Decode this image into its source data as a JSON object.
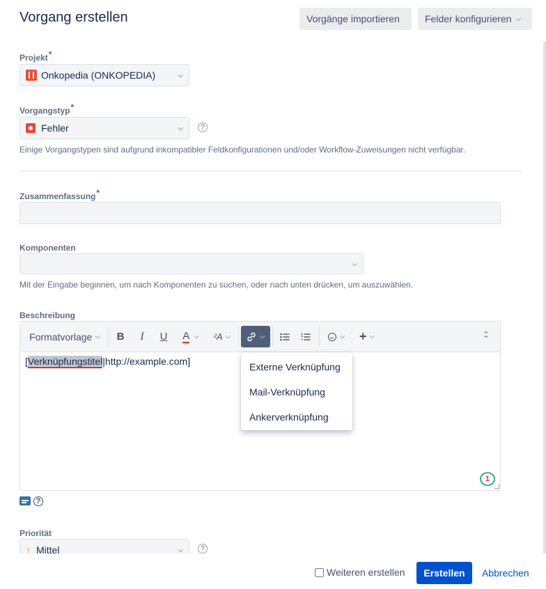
{
  "dialog": {
    "title": "Vorgang erstellen"
  },
  "header": {
    "import_label": "Vorgänge importieren",
    "configure_label": "Felder konfigurieren"
  },
  "project": {
    "label": "Projekt",
    "required_mark": "*",
    "value": "Onkopedia (ONKOPEDIA)"
  },
  "issue_type": {
    "label": "Vorgangstyp",
    "required_mark": "*",
    "value": "Fehler",
    "help": "?",
    "note": "Einige Vorgangstypen sind aufgrund inkompatibler Feldkonfigurationen und/oder Workflow-Zuweisungen nicht verfügbar."
  },
  "summary": {
    "label": "Zusammenfassung",
    "required_mark": "*",
    "value": ""
  },
  "components": {
    "label": "Komponenten",
    "value": "",
    "note": "Mit der Eingabe beginnen, um nach Komponenten zu suchen, oder nach unten drücken, um auszuwählen."
  },
  "description": {
    "label": "Beschreibung",
    "toolbar": {
      "format_label": "Formatvorlage",
      "bold": "B",
      "italic": "I",
      "underline": "U",
      "text_color": "A"
    },
    "content": {
      "open_bracket": "[",
      "link_title": "Verknüpfungstitel",
      "rest": "|http://example.com]"
    },
    "link_menu": [
      "Externe Verknüpfung",
      "Mail-Verknüpfung",
      "Ankerverknüpfung"
    ],
    "badge_count": "1",
    "help": "?"
  },
  "priority": {
    "label": "Priorität",
    "value": "Mittel",
    "help": "?"
  },
  "footer": {
    "create_another_label": "Weiteren erstellen",
    "create_label": "Erstellen",
    "cancel_label": "Abbrechen"
  },
  "colors": {
    "primary": "#0052cc",
    "required": "#de350b",
    "text": "#172b4d",
    "muted": "#5e6c84"
  }
}
